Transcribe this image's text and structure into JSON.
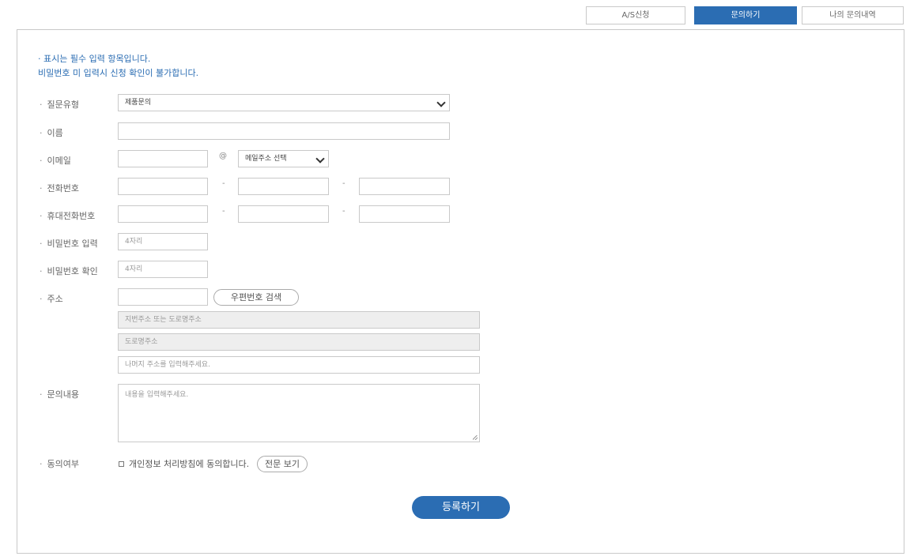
{
  "tabs": [
    {
      "label": "A/S신청",
      "active": false
    },
    {
      "label": "문의하기",
      "active": true
    },
    {
      "label": "나의 문의내역",
      "active": false
    }
  ],
  "notice": {
    "line1": "· 표시는 필수 입력 항목입니다.",
    "line2": "비밀번호 미 입력시 신청 확인이 불가합니다."
  },
  "labels": {
    "dot": "·",
    "question_type": "질문유형",
    "name": "이름",
    "email": "이메일",
    "phone": "전화번호",
    "mobile": "휴대전화번호",
    "password": "비밀번호 입력",
    "password_confirm": "비밀번호 확인",
    "address": "주소",
    "content": "문의내용",
    "agreement": "동의여부"
  },
  "form": {
    "question_type_value": "제품문의",
    "email_at": "@",
    "email_domain_value": "메일주소 선택",
    "dash": "-",
    "password_placeholder": "4자리",
    "password_confirm_placeholder": "4자리",
    "zip_button": "우편번호 검색",
    "address1_placeholder": "지번주소 또는 도로명주소",
    "address2_placeholder": "도로명주소",
    "address3_placeholder": "나머지 주소를 입력해주세요.",
    "content_placeholder": "내용을 입력해주세요.",
    "agree_text": "개인정보 처리방침에 동의합니다.",
    "view_full_button": "전문 보기",
    "submit_button": "등록하기"
  },
  "colors": {
    "accent": "#2b6db3",
    "border": "#c9c9c9",
    "readonly_bg": "#eeeeee"
  }
}
